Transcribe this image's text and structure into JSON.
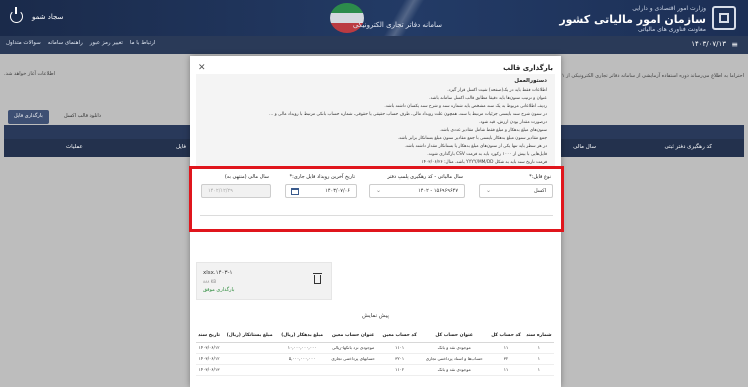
{
  "header": {
    "org_small": "وزارت امور اقتصادی و دارایی",
    "org_name": "سازمان امور مالیاتی کشور",
    "org_sub": "معاونت فناوری های مالیاتی",
    "system_title": "سامانه دفاتر تجاری الکترونیکی",
    "user_name": "سجاد شمو"
  },
  "navbar": {
    "date": "۱۴۰۳/۰۷/۱۳",
    "links": [
      "سوالات متداول",
      "راهنمای سامانه",
      "تغییر رمز عبور",
      "ارتباط با ما"
    ]
  },
  "background": {
    "info_left": "اطلاعات آغاز خواهد شد.",
    "info_right": "احتراما به اطلاع می‌رساند دوره استفاده آزمایشی از سامانه دفاتر تجاری الکترونیکی از ۱",
    "upload_button": "بارگذاری فایل",
    "template_button": "دانلود قالب اکسل",
    "col_actions": "عملیات",
    "col_file": "فایل",
    "col_fiscal_year": "سال مالی",
    "col_tracking": "کد رهگیری دفتر ثبتی"
  },
  "modal": {
    "title": "بارگذاری قالب",
    "close_icon": "close-icon",
    "guide": {
      "title": "دستورالعمل",
      "lines": [
        "اطلاعات فقط باید در یک(صفحه) شیت اکسل قرار گیرد.",
        "عنوان و ترتیب ستون‌ها باید دقیقا مطابق قالب اکسل سامانه باشد.",
        "ردیف اطلاعاتی مربوط به یک سند مشخص باید شماره سند و شرح سند یکسان داشته باشد.",
        "در ستون شرح سند بایستی جزئیات مرتبط با سند، همچون علت رویداد مالی، طرف حساب حقیقی یا حقوقی، شماره حساب بانکی مرتبط با رویداد مالی و ...",
        "درصورت مقدار بودن ارزش، قید شود.",
        "ستون‌های مبلغ بدهکار و مبلغ فقط شامل مقادیر عددی باشد.",
        "جمع مقادیر ستون مبلغ بدهکار بایستی با جمع مقادیر ستون مبلغ بستانکار برابر باشد.",
        "در هر سطر باید تنها یکی از ستون‌های مبلغ بدهکار یا بستانکار مقدار داشته باشد.",
        "فایل‌هایی با بیش از ۱۰۰۰ رکورد باید به فرمت CSV بارگذاری شوند.",
        "فرمت تاریخ سند باید به شکل YYYY/MM/DD باشد. مثال: ۱۴۰۳/۰۶/۲۶",
        "تاریخ سند باید در محدوده بازه زمانی فایل جاری قرار داشته باشد."
      ]
    },
    "form": {
      "file_type_label": "نوع فایل:*",
      "file_type_value": "اکسل",
      "fiscal_year_label": "سال مالیاتی - کد رهگیری پلمپ دفتر",
      "fiscal_year_value": "۱۵۶۹۶۹۶۴۷ - ۱۴۰۲",
      "last_event_date_label": "تاریخ آخرین رویداد فایل جاری:*",
      "last_event_date_value": "۱۴۰۳/۰۷/۰۶",
      "fiscal_year_end_label": "سال مالی (منتهی به)",
      "fiscal_year_end_value": "۱۴۰۲/۱۲/۲۹"
    },
    "file": {
      "name": "xlsx.۱۴۰۳-۱",
      "size": "۸۸۸ KB",
      "status": "بارگذاری موفق"
    },
    "preview": {
      "title": "پیش نمایش",
      "headers": [
        "شماره سند",
        "کد حساب کل",
        "عنوان حساب کل",
        "کد حساب معین",
        "عنوان حساب معین",
        "مبلغ بدهکار (ریال)",
        "مبلغ بستانکار (ریال)",
        "تاریخ سند"
      ],
      "rows": [
        [
          "۱",
          "۱۱",
          "موجودی نقد و بانک",
          "۱۱۰۱",
          "موجودی نزد بانکها-ریالی",
          "۱۰,۰۰۰,۰۰۰,۰۰۰",
          "",
          "۱۴۰۳/۰۶/۱۲"
        ],
        [
          "۱",
          "۳۲",
          "حساب‌ها و اسناد پرداختنی تجاری",
          "۳۲۰۱",
          "حسابهای پرداختنی تجاری",
          "۵,۰۰۰,۰۰۰,۰۰۰",
          "",
          "۱۴۰۳/۰۶/۱۲"
        ],
        [
          "۱",
          "۱۱",
          "موجودی نقد و بانک",
          "۱۱۰۲",
          "",
          "",
          "",
          "۱۴۰۳/۰۶/۱۳"
        ]
      ]
    }
  }
}
